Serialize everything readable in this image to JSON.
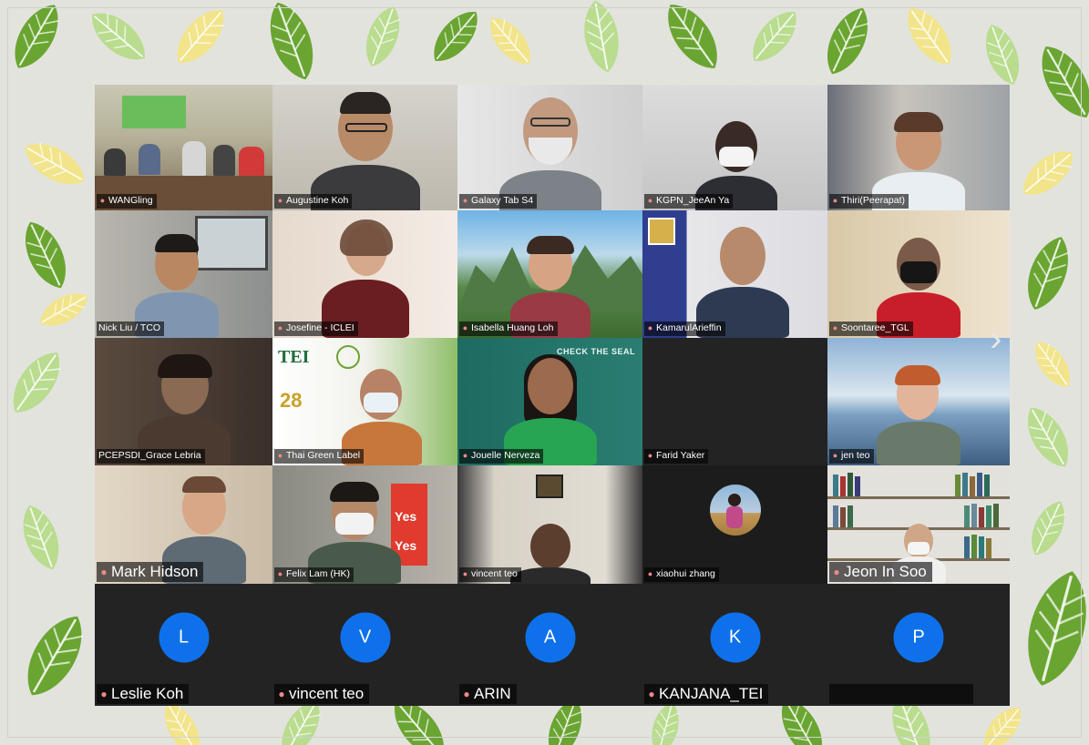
{
  "participants": [
    {
      "name": "WANGling",
      "type": "video",
      "scene": "meeting-room"
    },
    {
      "name": "Augustine Koh",
      "type": "video",
      "scene": "man-glasses"
    },
    {
      "name": "Galaxy Tab S4",
      "type": "video",
      "scene": "man-beard"
    },
    {
      "name": "KGPN_JeeAn Ya",
      "type": "video",
      "scene": "woman-mask"
    },
    {
      "name": "Thiri(Peerapat)",
      "type": "video",
      "scene": "woman-room"
    },
    {
      "name": "Nick Liu / TCO",
      "type": "video",
      "scene": "man-office"
    },
    {
      "name": "Josefine - ICLEI",
      "type": "video",
      "scene": "woman-light"
    },
    {
      "name": "Isabella Huang Loh",
      "type": "video",
      "scene": "mountains"
    },
    {
      "name": "KamarulArieffin",
      "type": "video",
      "scene": "man-banner"
    },
    {
      "name": "Soontaree_TGL",
      "type": "video",
      "scene": "woman-mask-red"
    },
    {
      "name": "PCEPSDI_Grace Lebria",
      "type": "video",
      "scene": "woman-dark"
    },
    {
      "name": "Thai Green Label",
      "type": "video",
      "scene": "tei-banner"
    },
    {
      "name": "Jouelle Nerveza",
      "type": "video",
      "scene": "check-the-seal"
    },
    {
      "name": "Farid Yaker",
      "type": "off",
      "scene": "blank"
    },
    {
      "name": "jen teo",
      "type": "video",
      "scene": "woman-sky"
    },
    {
      "name": "Mark Hidson",
      "type": "video",
      "scene": "man-room",
      "big": true
    },
    {
      "name": "Felix Lam (HK)",
      "type": "video",
      "scene": "man-mask-books"
    },
    {
      "name": "vincent teo",
      "type": "video",
      "scene": "man-dark"
    },
    {
      "name": "xiaohui zhang",
      "type": "photo",
      "scene": "profile-photo"
    },
    {
      "name": "Jeon In Soo",
      "type": "video",
      "scene": "library",
      "big": true
    },
    {
      "name": "Leslie Koh",
      "type": "initial",
      "initial": "L",
      "big": true
    },
    {
      "name": "vincent teo",
      "type": "initial",
      "initial": "V",
      "big": true
    },
    {
      "name": "ARIN",
      "type": "initial",
      "initial": "A",
      "big": true
    },
    {
      "name": "KANJANA_TEI",
      "type": "initial",
      "initial": "K",
      "big": true
    },
    {
      "name": "",
      "type": "initial",
      "initial": "P",
      "big": true
    }
  ],
  "banners": {
    "check_the_seal": "CHECK THE SEAL",
    "tei": "TEI",
    "tei_years": "28",
    "yes": "Yes"
  },
  "colors": {
    "avatar_blue": "#0e71eb",
    "leaf_green": "#6aa532",
    "leaf_light": "#b9dc8f",
    "leaf_yellow": "#f2e48a"
  },
  "icons": {
    "muted": "muted-mic-icon",
    "next": "chevron-right-icon"
  }
}
